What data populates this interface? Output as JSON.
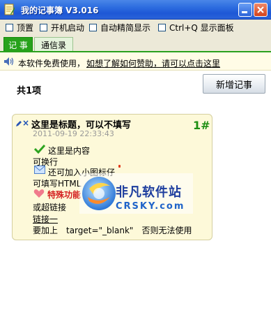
{
  "window": {
    "title": "我的记事簿 V3.016"
  },
  "options": [
    {
      "label": "顶置"
    },
    {
      "label": "开机启动"
    },
    {
      "label": "自动精简显示"
    },
    {
      "label": "Ctrl+Q 显示面板"
    }
  ],
  "tabs": [
    {
      "label": "记 事",
      "active": true
    },
    {
      "label": "通信录",
      "active": false
    }
  ],
  "notice": {
    "text": "本软件免费使用，",
    "link": "如想了解如何赞助，请可以点击这里"
  },
  "toolbar": {
    "count_label": "共1项",
    "new_button": "新增记事"
  },
  "note": {
    "title": "这里是标题，可以不填写",
    "number": "1#",
    "date": "2011-09-19 22:33:43",
    "lines": {
      "content": "这里是内容",
      "wrap": "可换行",
      "add_icon": "还可加入小图标仔",
      "html": "可填写HTML",
      "special": "特殊功能",
      "link_or": "或超链接",
      "link_one": "链接一",
      "target": "要加上　target=\"_blank\"　否则无法使用"
    }
  },
  "watermark": {
    "name": "非凡软件站",
    "domain": "CRSKY.com"
  },
  "colors": {
    "title_bar": "#2f6fe0",
    "tab_active": "#27a21b",
    "note_bg": "#fdf9d9",
    "number": "#1d8f12"
  }
}
